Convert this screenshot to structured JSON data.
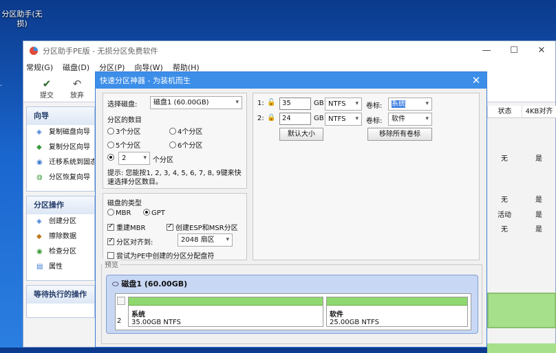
{
  "desktop": {
    "icon_label": "分区助手(无损)"
  },
  "app": {
    "title": "分区助手PE版 - 无损分区免费软件",
    "menu": [
      "常规(G)",
      "磁盘(D)",
      "分区(P)",
      "向导(W)",
      "帮助(H)"
    ],
    "toolbar": [
      {
        "label": "提交",
        "icon": "check-icon"
      },
      {
        "label": "放弃",
        "icon": "undo-icon"
      }
    ],
    "sidebar": {
      "wizard_title": "向导",
      "wizard_items": [
        "复制磁盘向导",
        "复制分区向导",
        "迁移系统到固态",
        "分区恢复向导"
      ],
      "ops_title": "分区操作",
      "ops_items": [
        "创建分区",
        "擦除数据",
        "检查分区",
        "属性"
      ],
      "pending_title": "等待执行的操作"
    },
    "right": {
      "headers": [
        "状态",
        "4KB对齐"
      ],
      "rows": [
        [
          "无",
          "是"
        ],
        [
          "无",
          "是"
        ],
        [
          "活动",
          "是"
        ],
        [
          "无",
          "是"
        ]
      ]
    }
  },
  "dialog": {
    "title": "快速分区神器 - 为装机而生",
    "select_disk_label": "选择磁盘:",
    "select_disk_value": "磁盘1 (60.00GB)",
    "partition_count_label": "分区的数目",
    "radios": [
      "3个分区",
      "4个分区",
      "5个分区",
      "6个分区"
    ],
    "custom_count": "2",
    "custom_count_suffix": "个分区",
    "hint": "提示: 您能按1, 2, 3, 4, 5, 6, 7, 8, 9键来快速选择分区数目。",
    "disk_type_label": "磁盘的类型",
    "mbr": "MBR",
    "gpt": "GPT",
    "rebuild_mbr": "重建MBR",
    "create_esp": "创建ESP和MSR分区",
    "align_label": "分区对齐到:",
    "align_value": "2048 扇区",
    "pe_letter": "尝试为PE中创建的分区分配盘符",
    "partitions": [
      {
        "index": "1:",
        "size": "35",
        "unit": "GB",
        "fs": "NTFS",
        "vol_label": "卷标:",
        "vol": "系统"
      },
      {
        "index": "2:",
        "size": "24",
        "unit": "GB",
        "fs": "NTFS",
        "vol_label": "卷标:",
        "vol": "软件"
      }
    ],
    "default_size_btn": "默认大小",
    "remove_labels_btn": "移除所有卷标",
    "preview_label": "预览",
    "preview_disk": "磁盘1 (60.00GB)",
    "preview_num": "2",
    "preview_parts": [
      {
        "name": "系统",
        "size": "35.00GB NTFS"
      },
      {
        "name": "软件",
        "size": "25.00GB NTFS"
      }
    ]
  },
  "colors": {
    "accent": "#3c8ee8",
    "partition_bar": "#90d870"
  }
}
